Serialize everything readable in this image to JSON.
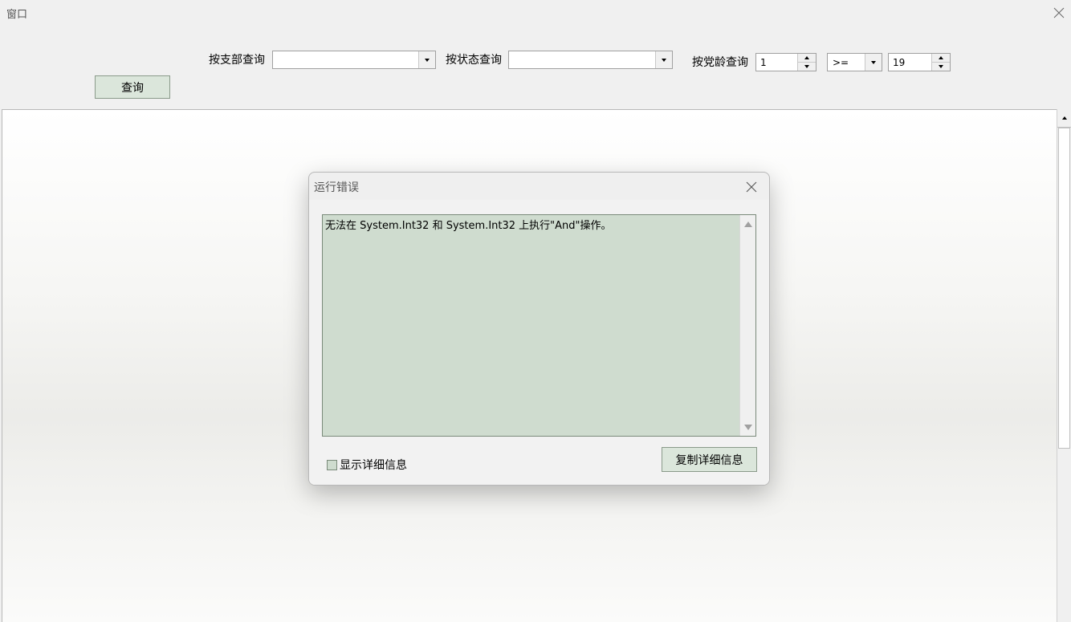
{
  "window": {
    "title": "窗口"
  },
  "toolbar": {
    "branch_label": "按支部查询",
    "branch_value": "",
    "status_label": "按状态查询",
    "status_value": "",
    "age_label": "按党龄查询",
    "age_min": "1",
    "operator": ">=",
    "age_max": "19",
    "query_label": "查询"
  },
  "dialog": {
    "title": "运行错误",
    "message": "无法在 System.Int32 和 System.Int32 上执行\"And\"操作。",
    "show_details_label": "显示详细信息",
    "show_details_checked": false,
    "copy_label": "复制详细信息"
  }
}
